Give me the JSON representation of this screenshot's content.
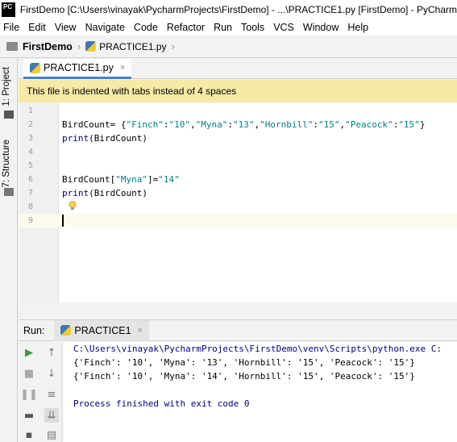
{
  "window": {
    "app_icon": "PC",
    "title": "FirstDemo [C:\\Users\\vinayak\\PycharmProjects\\FirstDemo] - ...\\PRACTICE1.py [FirstDemo] - PyCharm"
  },
  "menu": [
    "File",
    "Edit",
    "View",
    "Navigate",
    "Code",
    "Refactor",
    "Run",
    "Tools",
    "VCS",
    "Window",
    "Help"
  ],
  "breadcrumb": {
    "project": "FirstDemo",
    "file": "PRACTICE1.py"
  },
  "side_tabs": {
    "project": "1: Project",
    "structure": "7: Structure"
  },
  "editor_tab": {
    "label": "PRACTICE1.py",
    "close": "×"
  },
  "banner": "This file is indented with tabs instead of 4 spaces",
  "code": {
    "line_numbers": [
      "1",
      "2",
      "3",
      "4",
      "5",
      "6",
      "7",
      "8",
      "9"
    ],
    "line2_a": "BirdCount= {",
    "line2_k1": "\"Finch\"",
    "line2_c1": ":",
    "line2_v1": "\"10\"",
    "line2_s1": ",",
    "line2_k2": "\"Myna\"",
    "line2_c2": ":",
    "line2_v2": "\"13\"",
    "line2_s2": ",",
    "line2_k3": "\"Hornbill\"",
    "line2_c3": ":",
    "line2_v3": "\"15\"",
    "line2_s3": ",",
    "line2_k4": "\"Peacock\"",
    "line2_c4": ":",
    "line2_v4": "\"15\"",
    "line2_end": "}",
    "line3_fn": "print",
    "line3_rest": "(BirdCount)",
    "line6_a": "BirdCount[",
    "line6_k": "\"Myna\"",
    "line6_b": "]=",
    "line6_v": "\"14\"",
    "line7_fn": "print",
    "line7_rest": "(BirdCount)"
  },
  "run": {
    "label": "Run:",
    "tab": "PRACTICE1",
    "close": "×",
    "console": [
      "C:\\Users\\vinayak\\PycharmProjects\\FirstDemo\\venv\\Scripts\\python.exe C:",
      "{'Finch': '10', 'Myna': '13', 'Hornbill': '15', 'Peacock': '15'}",
      "{'Finch': '10', 'Myna': '14', 'Hornbill': '15', 'Peacock': '15'}",
      "Process finished with exit code 0"
    ]
  },
  "colors": {
    "banner_bg": "#f5eaa6",
    "string": "#008080",
    "builtin": "#000080",
    "tab_accent": "#4083c9",
    "run_green": "#3e9a3e"
  }
}
